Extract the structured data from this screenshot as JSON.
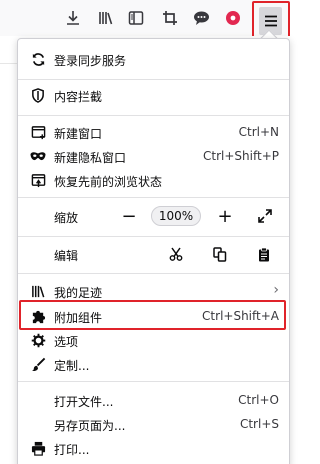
{
  "toolbar": {
    "icons": [
      "download-icon",
      "library-icon",
      "sidebar-icon",
      "crop-icon",
      "chat-icon",
      "record-icon",
      "hamburger-menu-icon"
    ]
  },
  "menu": {
    "sync": "登录同步服务",
    "content_blocking": "内容拦截",
    "new_window": {
      "label": "新建窗口",
      "shortcut": "Ctrl+N"
    },
    "new_private_window": {
      "label": "新建隐私窗口",
      "shortcut": "Ctrl+Shift+P"
    },
    "restore_session": "恢复先前的浏览状态",
    "zoom": {
      "label": "缩放",
      "minus": "−",
      "value": "100%",
      "plus": "+"
    },
    "edit": {
      "label": "编辑"
    },
    "library": "我的足迹",
    "addons": {
      "label": "附加组件",
      "shortcut": "Ctrl+Shift+A"
    },
    "options": "选项",
    "customize": "定制...",
    "open_file": {
      "label": "打开文件...",
      "shortcut": "Ctrl+O"
    },
    "save_page": {
      "label": "另存页面为...",
      "shortcut": "Ctrl+S"
    },
    "print": "打印..."
  },
  "colors": {
    "highlight": "#e0232a",
    "accent": "#0c0c0d"
  }
}
